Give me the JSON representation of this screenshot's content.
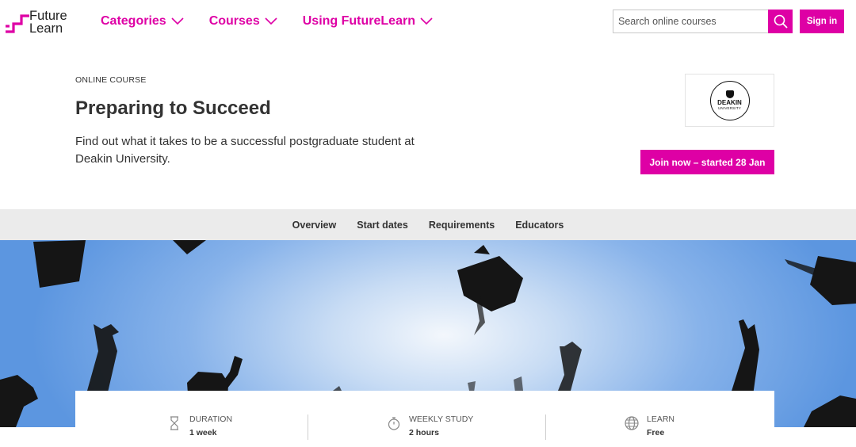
{
  "brand": {
    "logo_line1": "Future",
    "logo_line2": "Learn",
    "accent": "#de00a5"
  },
  "nav": {
    "items": [
      {
        "label": "Categories",
        "icon": "chevron-down-icon"
      },
      {
        "label": "Courses",
        "icon": "chevron-down-icon"
      },
      {
        "label": "Using FutureLearn",
        "icon": "chevron-down-icon"
      }
    ]
  },
  "search": {
    "placeholder": "Search online courses",
    "icon": "search-icon"
  },
  "header": {
    "signin_label": "Sign in"
  },
  "course": {
    "eyebrow": "ONLINE COURSE",
    "title": "Preparing to Succeed",
    "description": "Find out what it takes to be a successful postgraduate student at Deakin University.",
    "join_label": "Join now – started 28 Jan"
  },
  "university": {
    "name": "DEAKIN",
    "subtitle": "UNIVERSITY"
  },
  "tabs": [
    "Overview",
    "Start dates",
    "Requirements",
    "Educators"
  ],
  "stats": [
    {
      "label": "DURATION",
      "value": "1 week",
      "icon": "hourglass-icon"
    },
    {
      "label": "WEEKLY STUDY",
      "value": "2 hours",
      "icon": "stopwatch-icon"
    },
    {
      "label": "LEARN",
      "value": "Free",
      "icon": "globe-icon"
    }
  ]
}
